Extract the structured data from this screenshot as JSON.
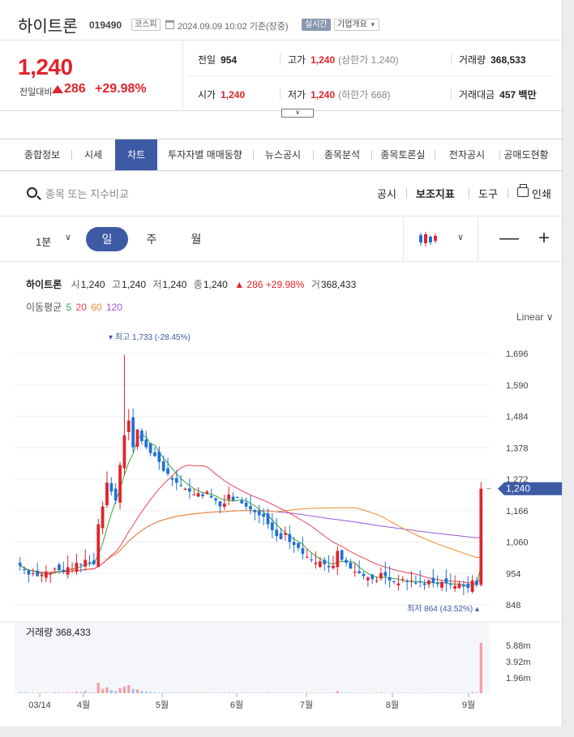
{
  "header": {
    "stock_name": "하이트론",
    "stock_code": "019490",
    "market_badge": "코스피",
    "datetime": "2024.09.09 10:02 기준(장중)",
    "live_badge": "실시간",
    "info_badge": "기업개요"
  },
  "quote": {
    "price": "1,240",
    "prev_label": "전일대비",
    "change_amount": "286",
    "change_percent": "+29.98%",
    "prev_close_label": "전일",
    "prev_close": "954",
    "high_label": "고가",
    "high": "1,240",
    "upper_limit": "(상한가 1,240)",
    "volume_label": "거래량",
    "volume": "368,533",
    "open_label": "시가",
    "open": "1,240",
    "low_label": "저가",
    "low": "1,240",
    "lower_limit": "(하한가 668)",
    "amount_label": "거래대금",
    "amount": "457 백만"
  },
  "tabs": [
    {
      "label": "종합정보",
      "active": false
    },
    {
      "label": "시세",
      "active": false
    },
    {
      "label": "차트",
      "active": true
    },
    {
      "label": "투자자별 매매동향",
      "active": false
    },
    {
      "label": "뉴스공시",
      "active": false
    },
    {
      "label": "종목분석",
      "active": false
    },
    {
      "label": "종목토론실",
      "active": false
    },
    {
      "label": "전자공시",
      "active": false
    },
    {
      "label": "공매도현황",
      "active": false
    }
  ],
  "toolbar": {
    "search_placeholder": "종목 또는 지수비교",
    "disclosure": "공시",
    "indicator": "보조지표",
    "tools": "도구",
    "print": "인쇄"
  },
  "period": {
    "minute": "1분",
    "day": "일",
    "week": "주",
    "month": "월",
    "zoom_out": "—",
    "zoom_in": "+"
  },
  "legend": {
    "name": "하이트론",
    "open_label": "시",
    "open": "1,240",
    "high_label": "고",
    "high": "1,240",
    "low_label": "저",
    "low": "1,240",
    "close_label": "종",
    "close": "1,240",
    "change": "▲ 286 +29.98%",
    "volume_label": "거",
    "volume": "368,433",
    "ma_label": "이동평균",
    "ma": [
      {
        "period": "5",
        "color": "#3aa63a"
      },
      {
        "period": "20",
        "color": "#e8465a"
      },
      {
        "period": "60",
        "color": "#f08a2a"
      },
      {
        "period": "120",
        "color": "#9a55d8"
      }
    ],
    "scale": "Linear"
  },
  "colors": {
    "up": "#e0242b",
    "down": "#1f72d6",
    "accent": "#3d5aa5",
    "current_tag": "#3d5aa5"
  },
  "chart_data": {
    "type": "candlestick",
    "y_ticks": [
      "1,696",
      "1,590",
      "1,484",
      "1,378",
      "1,272",
      "1,166",
      "1,060",
      "954",
      "848"
    ],
    "x_ticks": [
      "03/14",
      "4월",
      "5월",
      "6월",
      "7월",
      "8월",
      "9월"
    ],
    "current_price_tag": "1,240",
    "max_label": "최고 1,733 (-28.45%)",
    "min_label": "최저 864 (43.52%)",
    "volume_label": "거래량 368,433",
    "volume_ticks": [
      "5.88m",
      "3.92m",
      "1.96m"
    ],
    "close": [
      980,
      965,
      950,
      955,
      945,
      950,
      960,
      955,
      970,
      965,
      960,
      975,
      970,
      990,
      985,
      1000,
      990,
      985,
      1120,
      1180,
      1260,
      1230,
      1200,
      1320,
      1420,
      1470,
      1380,
      1440,
      1400,
      1380,
      1360,
      1350,
      1330,
      1300,
      1290,
      1270,
      1260,
      1250,
      1240,
      1230,
      1220,
      1225,
      1215,
      1230,
      1210,
      1200,
      1180,
      1190,
      1220,
      1200,
      1210,
      1190,
      1180,
      1170,
      1160,
      1150,
      1145,
      1120,
      1100,
      1080,
      1070,
      1090,
      1060,
      1050,
      1040,
      1020,
      1010,
      1000,
      990,
      995,
      985,
      975,
      980,
      1030,
      1000,
      990,
      970,
      960,
      955,
      945,
      940,
      935,
      930,
      955,
      945,
      930,
      925,
      920,
      935,
      925,
      930,
      920,
      925,
      915,
      930,
      922,
      918,
      925,
      920,
      915,
      912,
      920,
      910,
      905,
      930,
      915,
      1240
    ],
    "volume_m": [
      0.1,
      0.1,
      0.05,
      0.08,
      0.06,
      0.05,
      0.07,
      0.05,
      0.1,
      0.08,
      0.06,
      0.1,
      0.08,
      0.2,
      0.15,
      0.3,
      0.1,
      0.1,
      1.4,
      0.6,
      0.8,
      0.4,
      0.3,
      0.7,
      0.9,
      1.1,
      0.6,
      0.5,
      0.3,
      0.2,
      0.15,
      0.1,
      0.1,
      0.08,
      0.07,
      0.06,
      0.05,
      0.05,
      0.06,
      0.05,
      0.04,
      0.05,
      0.05,
      0.06,
      0.05,
      0.04,
      0.05,
      0.05,
      0.1,
      0.06,
      0.05,
      0.05,
      0.04,
      0.04,
      0.04,
      0.05,
      0.04,
      0.08,
      0.05,
      0.04,
      0.04,
      0.05,
      0.04,
      0.04,
      0.04,
      0.04,
      0.04,
      0.04,
      0.04,
      0.05,
      0.04,
      0.04,
      0.04,
      0.3,
      0.06,
      0.05,
      0.04,
      0.04,
      0.04,
      0.04,
      0.04,
      0.04,
      0.04,
      0.1,
      0.04,
      0.04,
      0.04,
      0.04,
      0.05,
      0.04,
      0.04,
      0.04,
      0.04,
      0.04,
      0.04,
      0.04,
      0.04,
      0.04,
      0.04,
      0.04,
      0.04,
      0.04,
      0.04,
      0.04,
      0.15,
      0.1,
      6.8
    ]
  }
}
